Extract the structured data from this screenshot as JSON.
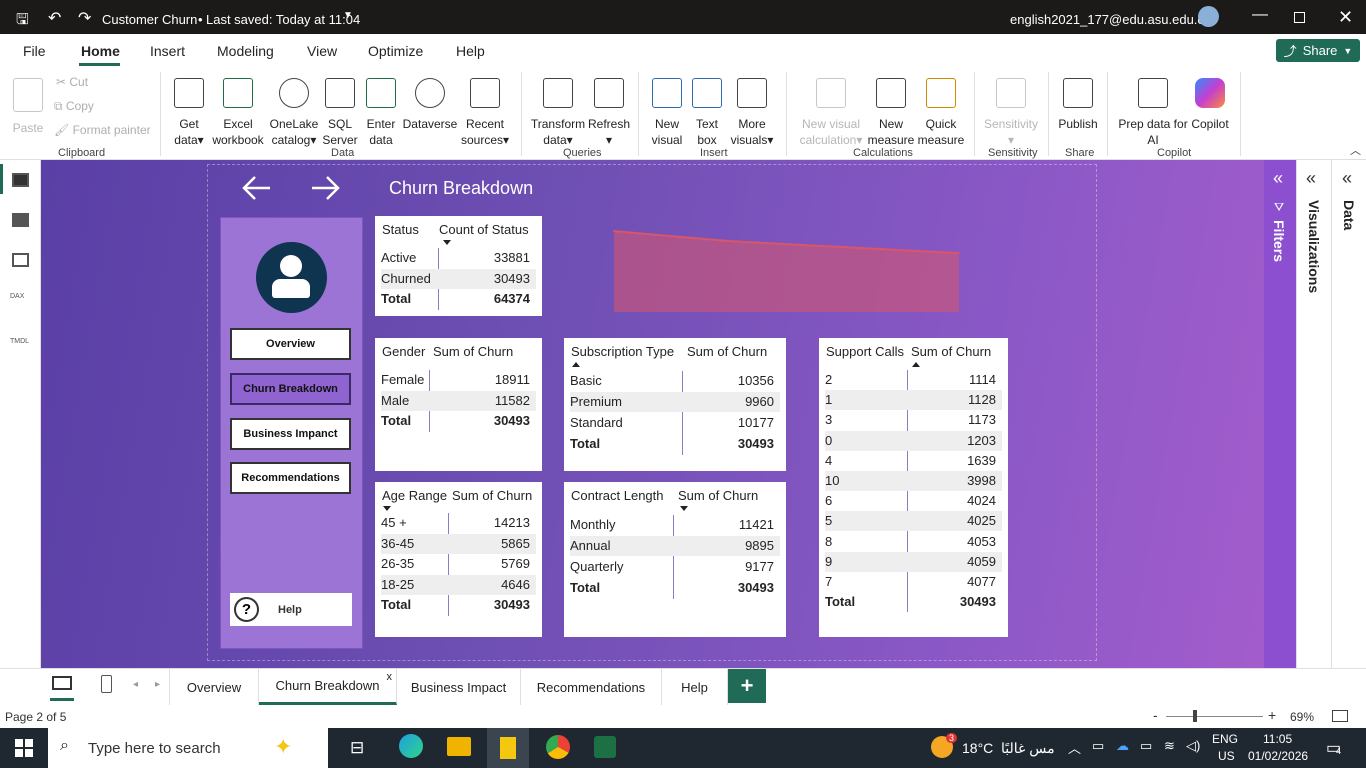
{
  "titlebar": {
    "doc_title": "Customer Churn",
    "saved": "Last saved: Today at 11:04",
    "account": "english2021_177@edu.asu.edu.eg"
  },
  "menu": {
    "items": [
      "File",
      "Home",
      "Insert",
      "Modeling",
      "View",
      "Optimize",
      "Help"
    ],
    "share": "Share"
  },
  "ribbon": {
    "clipboard": {
      "paste": "Paste",
      "cut": "Cut",
      "copy": "Copy",
      "format_painter": "Format painter",
      "group": "Clipboard"
    },
    "data": {
      "get_data": [
        "Get",
        "data"
      ],
      "excel": [
        "Excel",
        "workbook"
      ],
      "onelake": [
        "OneLake",
        "catalog"
      ],
      "sql": [
        "SQL",
        "Server"
      ],
      "enter": [
        "Enter",
        "data"
      ],
      "dataverse": "Dataverse",
      "recent": [
        "Recent",
        "sources"
      ],
      "group": "Data"
    },
    "queries": {
      "transform": [
        "Transform",
        "data"
      ],
      "refresh": "Refresh",
      "group": "Queries"
    },
    "insert": {
      "new_visual": [
        "New",
        "visual"
      ],
      "text_box": [
        "Text",
        "box"
      ],
      "more": [
        "More",
        "visuals"
      ],
      "group": "Insert"
    },
    "calculations": {
      "new_visual_calc": [
        "New visual",
        "calculation"
      ],
      "new_measure": [
        "New",
        "measure"
      ],
      "quick_measure": [
        "Quick",
        "measure"
      ],
      "group": "Calculations"
    },
    "sensitivity": {
      "label": "Sensitivity",
      "group": "Sensitivity"
    },
    "share": {
      "publish": "Publish",
      "group": "Share"
    },
    "copilot": {
      "prep": [
        "Prep data for",
        "AI"
      ],
      "copilot": "Copilot",
      "group": "Copilot"
    }
  },
  "canvas": {
    "page_title": "Churn Breakdown",
    "nav_buttons": [
      "Overview",
      "Churn Breakdown",
      "Business Impanct",
      "Recommendations"
    ],
    "help_label": "Help",
    "help_glyph": "?"
  },
  "panes": {
    "filters": "Filters",
    "visualizations": "Visualizations",
    "data": "Data"
  },
  "tables": {
    "status": {
      "col1": "Status",
      "col2": "Count of Status",
      "rows": [
        [
          "Active",
          "33881"
        ],
        [
          "Churned",
          "30493"
        ]
      ],
      "total": [
        "Total",
        "64374"
      ]
    },
    "gender": {
      "col1": "Gender",
      "col2": "Sum of Churn",
      "rows": [
        [
          "Female",
          "18911"
        ],
        [
          "Male",
          "11582"
        ]
      ],
      "total": [
        "Total",
        "30493"
      ]
    },
    "subscription": {
      "col1": "Subscription Type",
      "col2": "Sum of Churn",
      "rows": [
        [
          "Basic",
          "10356"
        ],
        [
          "Premium",
          "9960"
        ],
        [
          "Standard",
          "10177"
        ]
      ],
      "total": [
        "Total",
        "30493"
      ]
    },
    "age": {
      "col1": "Age Range",
      "col2": "Sum of Churn",
      "rows": [
        [
          "45 +",
          "14213"
        ],
        [
          "36-45",
          "5865"
        ],
        [
          "26-35",
          "5769"
        ],
        [
          "18-25",
          "4646"
        ]
      ],
      "total": [
        "Total",
        "30493"
      ]
    },
    "contract": {
      "col1": "Contract Length",
      "col2": "Sum of Churn",
      "rows": [
        [
          "Monthly",
          "11421"
        ],
        [
          "Annual",
          "9895"
        ],
        [
          "Quarterly",
          "9177"
        ]
      ],
      "total": [
        "Total",
        "30493"
      ]
    },
    "support": {
      "col1": "Support Calls",
      "col2": "Sum of Churn",
      "rows": [
        [
          "2",
          "1114"
        ],
        [
          "1",
          "1128"
        ],
        [
          "3",
          "1173"
        ],
        [
          "0",
          "1203"
        ],
        [
          "4",
          "1639"
        ],
        [
          "10",
          "3998"
        ],
        [
          "6",
          "4024"
        ],
        [
          "5",
          "4025"
        ],
        [
          "8",
          "4053"
        ],
        [
          "9",
          "4059"
        ],
        [
          "7",
          "4077"
        ]
      ],
      "total": [
        "Total",
        "30493"
      ]
    }
  },
  "chart_data": {
    "type": "area",
    "series": [
      {
        "values": [
          10356,
          10177,
          9960
        ]
      }
    ],
    "color": "#d9556a"
  },
  "page_tabs": [
    "Overview",
    "Churn Breakdown",
    "Business Impact",
    "Recommendations",
    "Help"
  ],
  "status": {
    "page": "Page 2 of 5",
    "zoom": "69%"
  },
  "taskbar": {
    "search_placeholder": "Type here to search",
    "weather_temp": "18°C",
    "weather_text": "مس غالبًا",
    "weather_badge": "3",
    "lang": "ENG",
    "region": "US",
    "time": "11:05",
    "date": "01/02/2026",
    "notif": "4"
  }
}
